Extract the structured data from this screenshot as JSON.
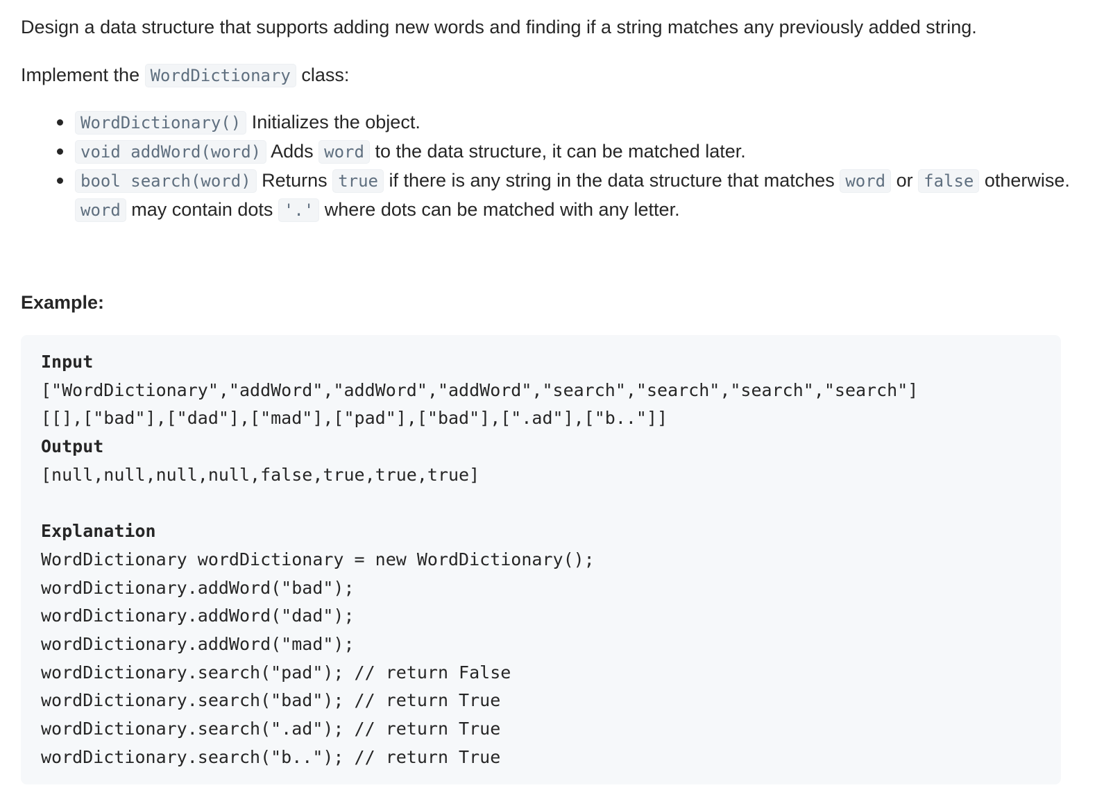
{
  "intro": "Design a data structure that supports adding new words and finding if a string matches any previously added string.",
  "implement": {
    "prefix": "Implement the ",
    "class_name": "WordDictionary",
    "suffix": " class:"
  },
  "bullets": [
    {
      "code": "WordDictionary()",
      "text": " Initializes the object."
    },
    {
      "code": "void addWord(word)",
      "text1": " Adds ",
      "code2": "word",
      "text2": " to the data structure, it can be matched later."
    },
    {
      "code": "bool search(word)",
      "text1": " Returns ",
      "code2": "true",
      "text2": " if there is any string in the data structure that matches ",
      "code3": "word",
      "text3": " or ",
      "code4": "false",
      "text4": " otherwise. ",
      "code5": "word",
      "text5": " may contain dots ",
      "code6": "'.'",
      "text6": " where dots can be matched with any letter."
    }
  ],
  "example_heading": "Example:",
  "example": {
    "input_label": "Input",
    "input_line1": "[\"WordDictionary\",\"addWord\",\"addWord\",\"addWord\",\"search\",\"search\",\"search\",\"search\"]",
    "input_line2": "[[],[\"bad\"],[\"dad\"],[\"mad\"],[\"pad\"],[\"bad\"],[\".ad\"],[\"b..\"]]",
    "output_label": "Output",
    "output_line": "[null,null,null,null,false,true,true,true]",
    "explanation_label": "Explanation",
    "explanation_lines": [
      "WordDictionary wordDictionary = new WordDictionary();",
      "wordDictionary.addWord(\"bad\");",
      "wordDictionary.addWord(\"dad\");",
      "wordDictionary.addWord(\"mad\");",
      "wordDictionary.search(\"pad\"); // return False",
      "wordDictionary.search(\"bad\"); // return True",
      "wordDictionary.search(\".ad\"); // return True",
      "wordDictionary.search(\"b..\"); // return True"
    ]
  }
}
